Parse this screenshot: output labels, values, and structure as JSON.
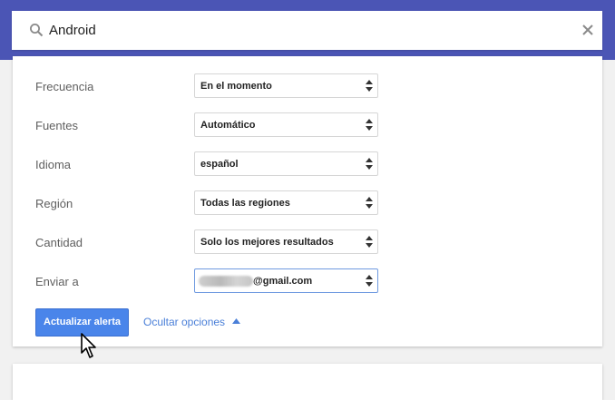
{
  "search": {
    "query": "Android",
    "icon": "search-icon",
    "clear_icon": "close-icon"
  },
  "options": [
    {
      "label": "Frecuencia",
      "value": "En el momento"
    },
    {
      "label": "Fuentes",
      "value": "Automático"
    },
    {
      "label": "Idioma",
      "value": "español"
    },
    {
      "label": "Región",
      "value": "Todas las regiones"
    },
    {
      "label": "Cantidad",
      "value": "Solo los mejores resultados"
    },
    {
      "label": "Enviar a",
      "value": "@gmail.com"
    }
  ],
  "actions": {
    "update_label": "Actualizar alerta",
    "hide_options_label": "Ocultar opciones"
  },
  "colors": {
    "header": "#4b55b5",
    "primary_button": "#4a85ea",
    "link": "#4a7fd8"
  }
}
